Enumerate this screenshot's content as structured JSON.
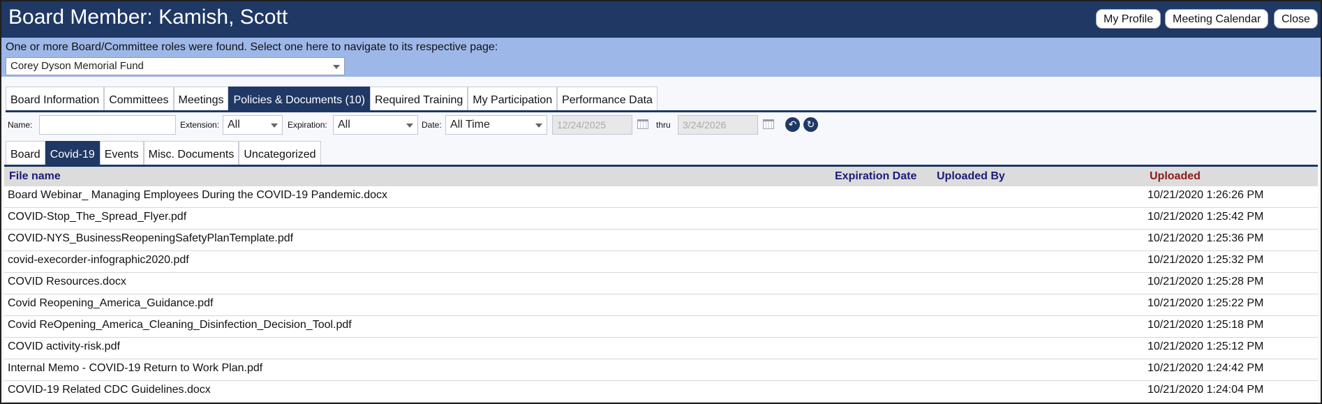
{
  "header": {
    "title": "Board Member: Kamish, Scott",
    "buttons": {
      "my_profile": "My Profile",
      "meeting_calendar": "Meeting Calendar",
      "close": "Close"
    }
  },
  "roles": {
    "message": "One or more Board/Committee roles were found.  Select one here to navigate to its respective page:",
    "selected": "Corey Dyson Memorial Fund"
  },
  "tabs": [
    {
      "label": "Board Information"
    },
    {
      "label": "Committees"
    },
    {
      "label": "Meetings"
    },
    {
      "label": "Policies & Documents (10)"
    },
    {
      "label": "Required Training"
    },
    {
      "label": "My Participation"
    },
    {
      "label": "Performance Data"
    }
  ],
  "filters": {
    "name_label": "Name:",
    "name_value": "",
    "extension_label": "Extension:",
    "extension_value": "All",
    "expiration_label": "Expiration:",
    "expiration_value": "All",
    "date_label": "Date:",
    "date_value": "All Time",
    "from_date": "12/24/2025",
    "thru_label": "thru",
    "to_date": "3/24/2026"
  },
  "subtabs": [
    {
      "label": "Board"
    },
    {
      "label": "Covid-19"
    },
    {
      "label": "Events"
    },
    {
      "label": "Misc. Documents"
    },
    {
      "label": "Uncategorized"
    }
  ],
  "table": {
    "headers": {
      "file_name": "File name",
      "expiration_date": "Expiration Date",
      "uploaded_by": "Uploaded By",
      "uploaded": "Uploaded"
    },
    "rows": [
      {
        "name": "Board Webinar_ Managing Employees During the COVID-19 Pandemic.docx",
        "uploaded": "10/21/2020 1:26:26 PM"
      },
      {
        "name": "COVID-Stop_The_Spread_Flyer.pdf",
        "uploaded": "10/21/2020 1:25:42 PM"
      },
      {
        "name": "COVID-NYS_BusinessReopeningSafetyPlanTemplate.pdf",
        "uploaded": "10/21/2020 1:25:36 PM"
      },
      {
        "name": "covid-execorder-infographic2020.pdf",
        "uploaded": "10/21/2020 1:25:32 PM"
      },
      {
        "name": "COVID Resources.docx",
        "uploaded": "10/21/2020 1:25:28 PM"
      },
      {
        "name": "Covid Reopening_America_Guidance.pdf",
        "uploaded": "10/21/2020 1:25:22 PM"
      },
      {
        "name": "Covid ReOpening_America_Cleaning_Disinfection_Decision_Tool.pdf",
        "uploaded": "10/21/2020 1:25:18 PM"
      },
      {
        "name": "COVID activity-risk.pdf",
        "uploaded": "10/21/2020 1:25:12 PM"
      },
      {
        "name": "Internal Memo - COVID-19 Return to Work Plan.pdf",
        "uploaded": "10/21/2020 1:24:42 PM"
      },
      {
        "name": "COVID-19 Related CDC Guidelines.docx",
        "uploaded": "10/21/2020 1:24:04 PM"
      }
    ]
  }
}
